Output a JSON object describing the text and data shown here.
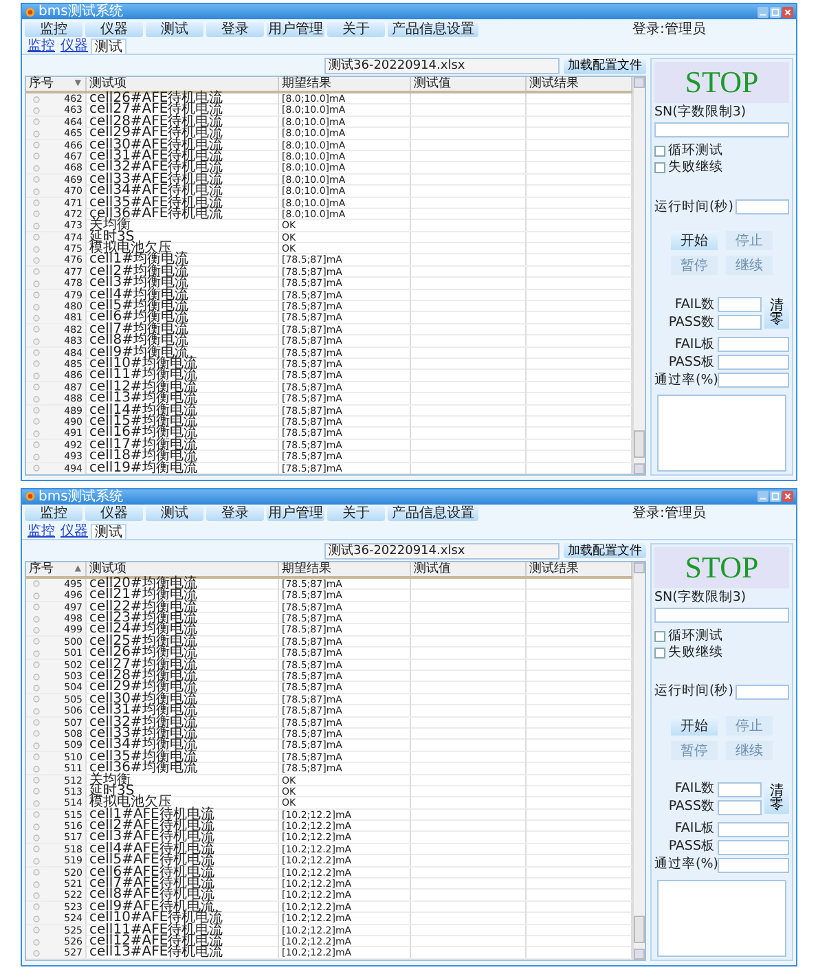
{
  "windows": [
    {
      "title": "bms测试系统",
      "menu": [
        "监控",
        "仪器",
        "测试",
        "登录",
        "用户管理",
        "关于",
        "产品信息设置"
      ],
      "user_status": "登录:管理员",
      "tabs": [
        {
          "label": "监控",
          "selected": false
        },
        {
          "label": "仪器",
          "selected": false
        },
        {
          "label": "测试",
          "selected": true
        }
      ],
      "file_name": "测试36-20220914.xlsx",
      "load_button": "加载配置文件",
      "columns": [
        {
          "label": "序号",
          "sort_icon": "▼"
        },
        {
          "label": "测试项"
        },
        {
          "label": "期望结果"
        },
        {
          "label": "测试值"
        },
        {
          "label": "测试结果"
        }
      ],
      "rows": [
        {
          "no": "462",
          "item": "cell26#AFE待机电流",
          "expected": "[8.0;10.0]mA"
        },
        {
          "no": "463",
          "item": "cell27#AFE待机电流",
          "expected": "[8.0;10.0]mA"
        },
        {
          "no": "464",
          "item": "cell28#AFE待机电流",
          "expected": "[8.0;10.0]mA"
        },
        {
          "no": "465",
          "item": "cell29#AFE待机电流",
          "expected": "[8.0;10.0]mA"
        },
        {
          "no": "466",
          "item": "cell30#AFE待机电流",
          "expected": "[8.0;10.0]mA"
        },
        {
          "no": "467",
          "item": "cell31#AFE待机电流",
          "expected": "[8.0;10.0]mA"
        },
        {
          "no": "468",
          "item": "cell32#AFE待机电流",
          "expected": "[8.0;10.0]mA"
        },
        {
          "no": "469",
          "item": "cell33#AFE待机电流",
          "expected": "[8.0;10.0]mA"
        },
        {
          "no": "470",
          "item": "cell34#AFE待机电流",
          "expected": "[8.0;10.0]mA"
        },
        {
          "no": "471",
          "item": "cell35#AFE待机电流",
          "expected": "[8.0;10.0]mA"
        },
        {
          "no": "472",
          "item": "cell36#AFE待机电流",
          "expected": "[8.0;10.0]mA"
        },
        {
          "no": "473",
          "item": "关均衡",
          "expected": "OK"
        },
        {
          "no": "474",
          "item": "延时3S",
          "expected": "OK"
        },
        {
          "no": "475",
          "item": "模拟电池欠压",
          "expected": "OK"
        },
        {
          "no": "476",
          "item": "cell1#均衡电流",
          "expected": "[78.5;87]mA"
        },
        {
          "no": "477",
          "item": "cell2#均衡电流",
          "expected": "[78.5;87]mA"
        },
        {
          "no": "478",
          "item": "cell3#均衡电流",
          "expected": "[78.5;87]mA"
        },
        {
          "no": "479",
          "item": "cell4#均衡电流",
          "expected": "[78.5;87]mA"
        },
        {
          "no": "480",
          "item": "cell5#均衡电流",
          "expected": "[78.5;87]mA"
        },
        {
          "no": "481",
          "item": "cell6#均衡电流",
          "expected": "[78.5;87]mA"
        },
        {
          "no": "482",
          "item": "cell7#均衡电流",
          "expected": "[78.5;87]mA"
        },
        {
          "no": "483",
          "item": "cell8#均衡电流",
          "expected": "[78.5;87]mA"
        },
        {
          "no": "484",
          "item": "cell9#均衡电流",
          "expected": "[78.5;87]mA"
        },
        {
          "no": "485",
          "item": "cell10#均衡电流",
          "expected": "[78.5;87]mA"
        },
        {
          "no": "486",
          "item": "cell11#均衡电流",
          "expected": "[78.5;87]mA"
        },
        {
          "no": "487",
          "item": "cell12#均衡电流",
          "expected": "[78.5;87]mA"
        },
        {
          "no": "488",
          "item": "cell13#均衡电流",
          "expected": "[78.5;87]mA"
        },
        {
          "no": "489",
          "item": "cell14#均衡电流",
          "expected": "[78.5;87]mA"
        },
        {
          "no": "490",
          "item": "cell15#均衡电流",
          "expected": "[78.5;87]mA"
        },
        {
          "no": "491",
          "item": "cell16#均衡电流",
          "expected": "[78.5;87]mA"
        },
        {
          "no": "492",
          "item": "cell17#均衡电流",
          "expected": "[78.5;87]mA"
        },
        {
          "no": "493",
          "item": "cell18#均衡电流",
          "expected": "[78.5;87]mA"
        },
        {
          "no": "494",
          "item": "cell19#均衡电流",
          "expected": "[78.5;87]mA"
        }
      ],
      "panel": {
        "status": "STOP",
        "sn_label": "SN(字数限制3)",
        "checkboxes": [
          {
            "label": "循环测试",
            "checked": false
          },
          {
            "label": "失败继续",
            "checked": false
          }
        ],
        "runtime_label": "运行时间(秒)",
        "buttons": [
          {
            "label": "开始",
            "disabled": false
          },
          {
            "label": "停止",
            "disabled": true
          },
          {
            "label": "暂停",
            "disabled": true
          },
          {
            "label": "继续",
            "disabled": true
          }
        ],
        "counters": [
          "FAIL数",
          "PASS数"
        ],
        "clear_button": "清零",
        "stats": [
          "FAIL板",
          "PASS板",
          "通过率(%)"
        ]
      }
    },
    {
      "title": "bms测试系统",
      "menu": [
        "监控",
        "仪器",
        "测试",
        "登录",
        "用户管理",
        "关于",
        "产品信息设置"
      ],
      "user_status": "登录:管理员",
      "tabs": [
        {
          "label": "监控",
          "selected": false
        },
        {
          "label": "仪器",
          "selected": false
        },
        {
          "label": "测试",
          "selected": true
        }
      ],
      "file_name": "测试36-20220914.xlsx",
      "load_button": "加载配置文件",
      "columns": [
        {
          "label": "序号",
          "sort_icon": "▲"
        },
        {
          "label": "测试项"
        },
        {
          "label": "期望结果"
        },
        {
          "label": "测试值"
        },
        {
          "label": "测试结果"
        }
      ],
      "rows": [
        {
          "no": "495",
          "item": "cell20#均衡电流",
          "expected": "[78.5;87]mA"
        },
        {
          "no": "496",
          "item": "cell21#均衡电流",
          "expected": "[78.5;87]mA"
        },
        {
          "no": "497",
          "item": "cell22#均衡电流",
          "expected": "[78.5;87]mA"
        },
        {
          "no": "498",
          "item": "cell23#均衡电流",
          "expected": "[78.5;87]mA"
        },
        {
          "no": "499",
          "item": "cell24#均衡电流",
          "expected": "[78.5;87]mA"
        },
        {
          "no": "500",
          "item": "cell25#均衡电流",
          "expected": "[78.5;87]mA"
        },
        {
          "no": "501",
          "item": "cell26#均衡电流",
          "expected": "[78.5;87]mA"
        },
        {
          "no": "502",
          "item": "cell27#均衡电流",
          "expected": "[78.5;87]mA"
        },
        {
          "no": "503",
          "item": "cell28#均衡电流",
          "expected": "[78.5;87]mA"
        },
        {
          "no": "504",
          "item": "cell29#均衡电流",
          "expected": "[78.5;87]mA"
        },
        {
          "no": "505",
          "item": "cell30#均衡电流",
          "expected": "[78.5;87]mA"
        },
        {
          "no": "506",
          "item": "cell31#均衡电流",
          "expected": "[78.5;87]mA"
        },
        {
          "no": "507",
          "item": "cell32#均衡电流",
          "expected": "[78.5;87]mA"
        },
        {
          "no": "508",
          "item": "cell33#均衡电流",
          "expected": "[78.5;87]mA"
        },
        {
          "no": "509",
          "item": "cell34#均衡电流",
          "expected": "[78.5;87]mA"
        },
        {
          "no": "510",
          "item": "cell35#均衡电流",
          "expected": "[78.5;87]mA"
        },
        {
          "no": "511",
          "item": "cell36#均衡电流",
          "expected": "[78.5;87]mA"
        },
        {
          "no": "512",
          "item": "关均衡",
          "expected": "OK"
        },
        {
          "no": "513",
          "item": "延时3S",
          "expected": "OK"
        },
        {
          "no": "514",
          "item": "模拟电池欠压",
          "expected": "OK"
        },
        {
          "no": "515",
          "item": "cell1#AFE待机电流",
          "expected": "[10.2;12.2]mA"
        },
        {
          "no": "516",
          "item": "cell2#AFE待机电流",
          "expected": "[10.2;12.2]mA"
        },
        {
          "no": "517",
          "item": "cell3#AFE待机电流",
          "expected": "[10.2;12.2]mA"
        },
        {
          "no": "518",
          "item": "cell4#AFE待机电流",
          "expected": "[10.2;12.2]mA"
        },
        {
          "no": "519",
          "item": "cell5#AFE待机电流",
          "expected": "[10.2;12.2]mA"
        },
        {
          "no": "520",
          "item": "cell6#AFE待机电流",
          "expected": "[10.2;12.2]mA"
        },
        {
          "no": "521",
          "item": "cell7#AFE待机电流",
          "expected": "[10.2;12.2]mA"
        },
        {
          "no": "522",
          "item": "cell8#AFE待机电流",
          "expected": "[10.2;12.2]mA"
        },
        {
          "no": "523",
          "item": "cell9#AFE待机电流",
          "expected": "[10.2;12.2]mA"
        },
        {
          "no": "524",
          "item": "cell10#AFE待机电流",
          "expected": "[10.2;12.2]mA"
        },
        {
          "no": "525",
          "item": "cell11#AFE待机电流",
          "expected": "[10.2;12.2]mA"
        },
        {
          "no": "526",
          "item": "cell12#AFE待机电流",
          "expected": "[10.2;12.2]mA"
        },
        {
          "no": "527",
          "item": "cell13#AFE待机电流",
          "expected": "[10.2;12.2]mA"
        }
      ],
      "panel": {
        "status": "STOP",
        "sn_label": "SN(字数限制3)",
        "checkboxes": [
          {
            "label": "循环测试",
            "checked": false
          },
          {
            "label": "失败继续",
            "checked": false
          }
        ],
        "runtime_label": "运行时间(秒)",
        "buttons": [
          {
            "label": "开始",
            "disabled": false
          },
          {
            "label": "停止",
            "disabled": true
          },
          {
            "label": "暂停",
            "disabled": true
          },
          {
            "label": "继续",
            "disabled": true
          }
        ],
        "counters": [
          "FAIL数",
          "PASS数"
        ],
        "clear_button": "清零",
        "stats": [
          "FAIL板",
          "PASS板",
          "通过率(%)"
        ]
      }
    }
  ]
}
